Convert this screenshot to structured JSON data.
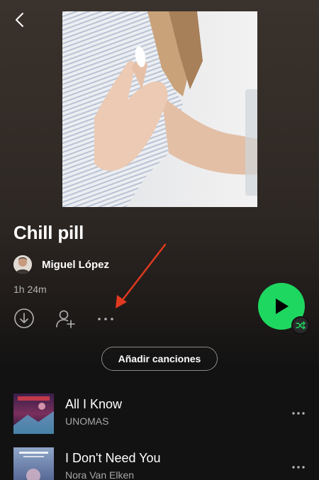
{
  "playlist": {
    "title": "Chill pill",
    "owner": "Miguel López",
    "duration": "1h 24m"
  },
  "actions": {
    "download_icon": "download-circle-icon",
    "follow_icon": "add-user-icon",
    "more_icon": "more-horizontal-icon",
    "play_icon": "play-icon",
    "shuffle_icon": "shuffle-icon"
  },
  "add_songs_label": "Añadir canciones",
  "tracks": [
    {
      "title": "All I Know",
      "artist": "UNOMAS"
    },
    {
      "title": "I Don't Need You",
      "artist": "Nora Van Elken"
    }
  ],
  "colors": {
    "accent_green": "#1ed760",
    "background": "#121212",
    "annotation_arrow": "#e0391f"
  }
}
